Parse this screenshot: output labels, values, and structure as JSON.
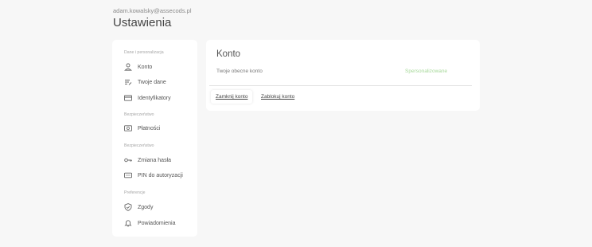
{
  "header": {
    "email": "adam.kowalsky@assecods.pl",
    "title": "Ustawienia"
  },
  "sidebar": {
    "sections": [
      {
        "label": "Dane i personalizacja",
        "items": [
          {
            "label": "Konto",
            "icon": "person-icon"
          },
          {
            "label": "Twoje dane",
            "icon": "edit-list-icon"
          },
          {
            "label": "Identyfikatory",
            "icon": "card-icon"
          }
        ]
      },
      {
        "label": "Bezpieczeństwo",
        "items": [
          {
            "label": "Płatności",
            "icon": "payment-icon"
          }
        ]
      },
      {
        "label": "Bezpieczeństwo",
        "items": [
          {
            "label": "Zmiana hasła",
            "icon": "key-icon"
          },
          {
            "label": "PIN do autoryzacji",
            "icon": "pin-icon"
          }
        ]
      },
      {
        "label": "Preferencje",
        "items": [
          {
            "label": "Zgody",
            "icon": "shield-check-icon"
          },
          {
            "label": "Powiadomienia",
            "icon": "bell-icon"
          }
        ]
      }
    ]
  },
  "main": {
    "title": "Konto",
    "current_account_label": "Twoje obecne konto",
    "current_account_value": "Spersonalizowane",
    "actions": {
      "close": "Zamknij konto",
      "block": "Zablokuj konto"
    }
  },
  "colors": {
    "background": "#f7f7f7",
    "card": "#ffffff",
    "accent_green": "#a7d99a"
  }
}
